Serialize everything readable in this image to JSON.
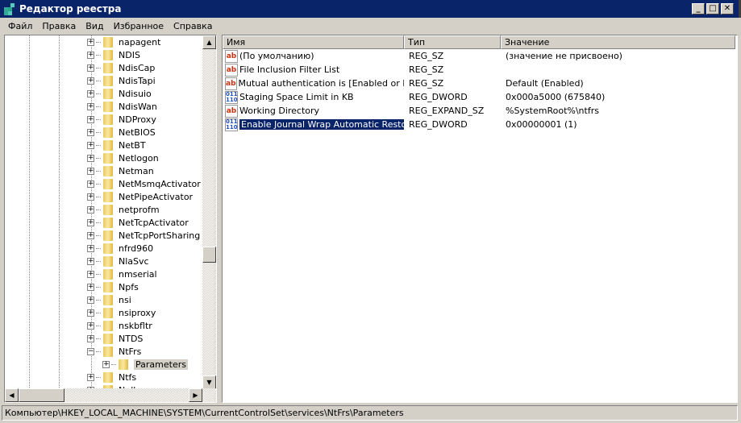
{
  "window": {
    "title": "Редактор реестра",
    "min": "_",
    "max": "□",
    "close": "✕"
  },
  "menu": [
    {
      "label": "Файл"
    },
    {
      "label": "Правка"
    },
    {
      "label": "Вид"
    },
    {
      "label": "Избранное"
    },
    {
      "label": "Справка"
    }
  ],
  "tree": {
    "items": [
      {
        "label": "napagent",
        "expander": "+"
      },
      {
        "label": "NDIS",
        "expander": "+"
      },
      {
        "label": "NdisCap",
        "expander": "+"
      },
      {
        "label": "NdisTapi",
        "expander": "+"
      },
      {
        "label": "Ndisuio",
        "expander": "+"
      },
      {
        "label": "NdisWan",
        "expander": "+"
      },
      {
        "label": "NDProxy",
        "expander": "+"
      },
      {
        "label": "NetBIOS",
        "expander": "+"
      },
      {
        "label": "NetBT",
        "expander": "+"
      },
      {
        "label": "Netlogon",
        "expander": "+"
      },
      {
        "label": "Netman",
        "expander": "+"
      },
      {
        "label": "NetMsmqActivator",
        "expander": "+"
      },
      {
        "label": "NetPipeActivator",
        "expander": "+"
      },
      {
        "label": "netprofm",
        "expander": "+"
      },
      {
        "label": "NetTcpActivator",
        "expander": "+"
      },
      {
        "label": "NetTcpPortSharing",
        "expander": "+"
      },
      {
        "label": "nfrd960",
        "expander": "+"
      },
      {
        "label": "NlaSvc",
        "expander": "+"
      },
      {
        "label": "nmserial",
        "expander": "+"
      },
      {
        "label": "Npfs",
        "expander": "+"
      },
      {
        "label": "nsi",
        "expander": "+"
      },
      {
        "label": "nsiproxy",
        "expander": "+"
      },
      {
        "label": "nskbfltr",
        "expander": "+"
      },
      {
        "label": "NTDS",
        "expander": "+"
      },
      {
        "label": "NtFrs",
        "expander": "−"
      },
      {
        "label": "Parameters",
        "expander": "+",
        "child": true,
        "selected": true
      },
      {
        "label": "Ntfs",
        "expander": "+"
      },
      {
        "label": "Null",
        "expander": "+"
      }
    ]
  },
  "list": {
    "columns": [
      "Имя",
      "Тип",
      "Значение"
    ],
    "rows": [
      {
        "name": "(По умолчанию)",
        "type": "REG_SZ",
        "value": "(значение не присвоено)",
        "icon": "string-value-icon"
      },
      {
        "name": "File Inclusion Filter List",
        "type": "REG_SZ",
        "value": "",
        "icon": "string-value-icon"
      },
      {
        "name": "Mutual authentication is [Enabled or Dis...",
        "type": "REG_SZ",
        "value": "Default (Enabled)",
        "icon": "string-value-icon"
      },
      {
        "name": "Staging Space Limit in KB",
        "type": "REG_DWORD",
        "value": "0x000a5000 (675840)",
        "icon": "binary-value-icon"
      },
      {
        "name": "Working Directory",
        "type": "REG_EXPAND_SZ",
        "value": "%SystemRoot%\\ntfrs",
        "icon": "string-value-icon"
      },
      {
        "name": "Enable Journal Wrap Automatic Restore",
        "type": "REG_DWORD",
        "value": "0x00000001 (1)",
        "icon": "binary-value-icon",
        "selected": true
      }
    ]
  },
  "status": "Компьютер\\HKEY_LOCAL_MACHINE\\SYSTEM\\CurrentControlSet\\services\\NtFrs\\Parameters",
  "colors": {
    "titlebar": "#0a246a",
    "selection": "#0a246a",
    "chrome": "#d4d0c8"
  }
}
